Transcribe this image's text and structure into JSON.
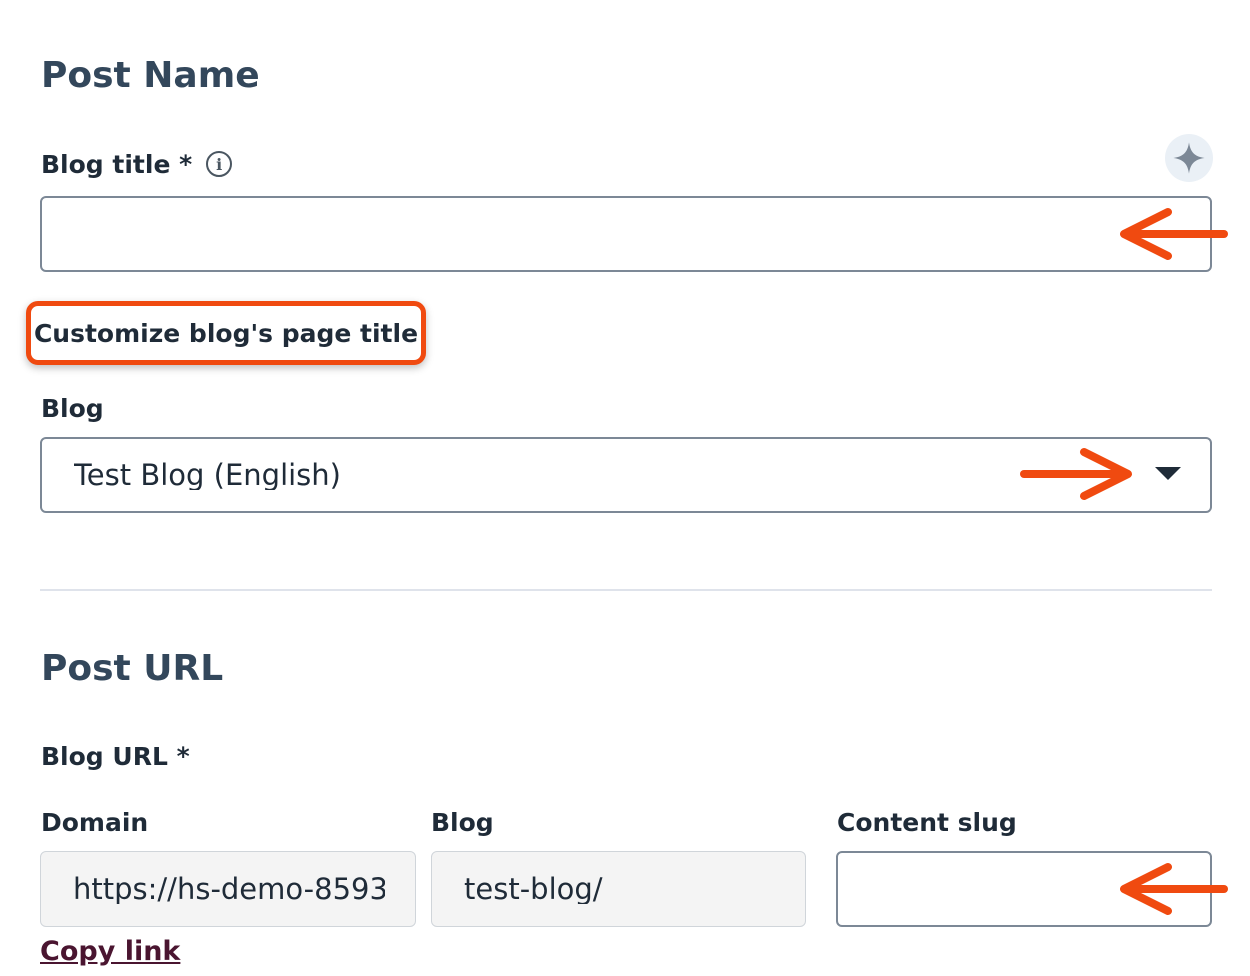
{
  "post_name": {
    "heading": "Post Name",
    "blog_title": {
      "label": "Blog title *",
      "value": "",
      "info_icon": "info-circle-icon",
      "ai_icon": "sparkle-icon"
    },
    "customize_link": "Customize blog's page title",
    "blog": {
      "label": "Blog",
      "selected": "Test Blog (English)",
      "dropdown_icon": "caret-down-icon"
    }
  },
  "post_url": {
    "heading": "Post URL",
    "blog_url_label": "Blog URL *",
    "domain": {
      "label": "Domain",
      "value": "https://hs-demo-8593"
    },
    "blog": {
      "label": "Blog",
      "value": "test-blog/"
    },
    "content_slug": {
      "label": "Content slug",
      "value": ""
    },
    "copy_link": "Copy link"
  },
  "annotations": {
    "arrow_icon": "arrow-icon",
    "arrow_color": "#f04a10",
    "highlight_color": "#f04a10"
  },
  "colors": {
    "heading": "#33475b",
    "text": "#1f2b38",
    "border": "#7c8896",
    "readonly_bg": "#f4f4f4",
    "link": "#4a1530"
  }
}
